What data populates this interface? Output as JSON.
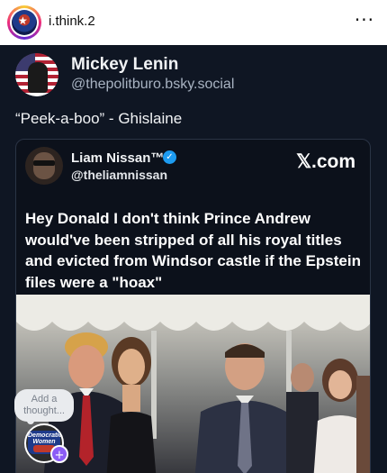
{
  "instagram": {
    "username": "i.think.2",
    "more_icon": "more-horizontal-icon",
    "more_glyph": "···"
  },
  "post": {
    "author_name": "Mickey Lenin",
    "author_handle": "@thepolitburo.bsky.social",
    "text": "“Peek-a-boo” - Ghislaine"
  },
  "embed": {
    "name": "Liam Nissan™",
    "handle": "@theliamnissan",
    "source": "𝕏.com",
    "text": "Hey Donald I don't think Prince Andrew would've been stripped of all his royal titles and evicted from Windsor castle if the Epstein files were a \"hoax\""
  },
  "overlay": {
    "thought_placeholder": "Add a thought...",
    "story_badge_text": "Democratic Women",
    "plus_glyph": "+"
  },
  "colors": {
    "post_bg": "#0f1623",
    "card_border": "#2a3445",
    "verified_blue": "#1d9bf0",
    "story_plus": "#8b5cf6"
  }
}
